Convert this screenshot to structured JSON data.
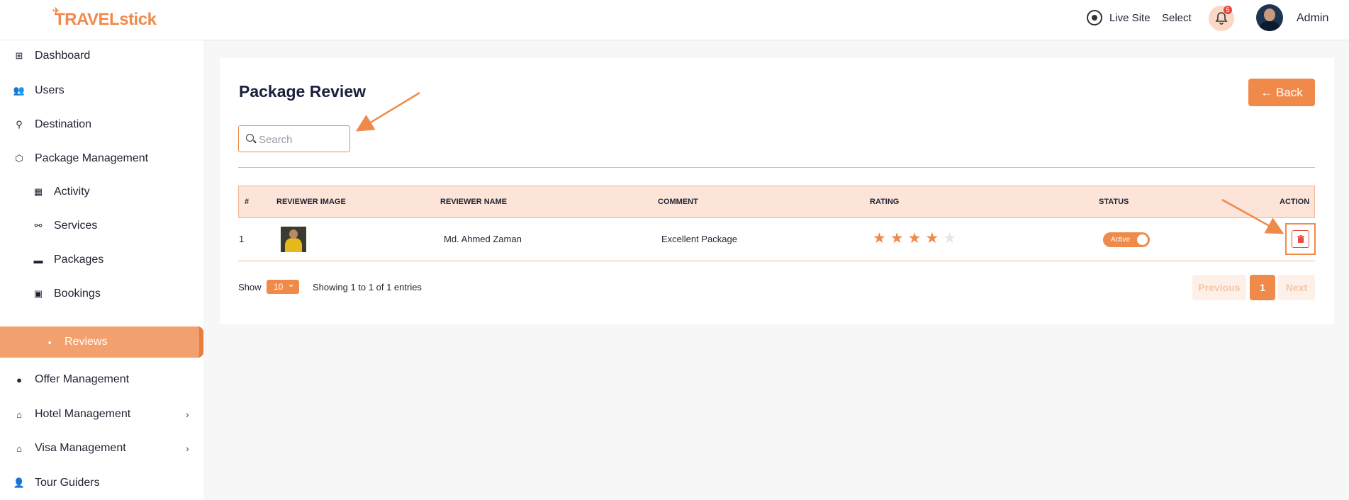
{
  "app": {
    "logo_part1": "TRAVEL",
    "logo_part2": "stick",
    "accent": "#f08a4b"
  },
  "topbar": {
    "live_site": "Live Site",
    "select": "Select",
    "notif_count": "5",
    "user": "Admin"
  },
  "sidebar": {
    "items": [
      {
        "label": "Dashboard"
      },
      {
        "label": "Users"
      },
      {
        "label": "Destination"
      },
      {
        "label": "Package Management"
      },
      {
        "label": "Activity"
      },
      {
        "label": "Services"
      },
      {
        "label": "Packages"
      },
      {
        "label": "Bookings"
      },
      {
        "label": "Reviews"
      },
      {
        "label": "Offer Management"
      },
      {
        "label": "Hotel Management"
      },
      {
        "label": "Visa Management"
      },
      {
        "label": "Tour Guiders"
      }
    ]
  },
  "page": {
    "title": "Package Review",
    "back": "← Back",
    "search_placeholder": "Search"
  },
  "table": {
    "headers": [
      "#",
      "REVIEWER IMAGE",
      "REVIEWER NAME",
      "COMMENT",
      "RATING",
      "STATUS",
      "ACTION"
    ],
    "rows": [
      {
        "num": "1",
        "name": "Md. Ahmed Zaman",
        "comment": "Excellent Package",
        "rating": 4,
        "rating_max": 5,
        "status": "Active"
      }
    ]
  },
  "footer": {
    "show": "Show",
    "page_size": "10",
    "entries": "Showing 1 to 1 of 1 entries",
    "prev": "Previous",
    "page": "1",
    "next": "Next"
  }
}
